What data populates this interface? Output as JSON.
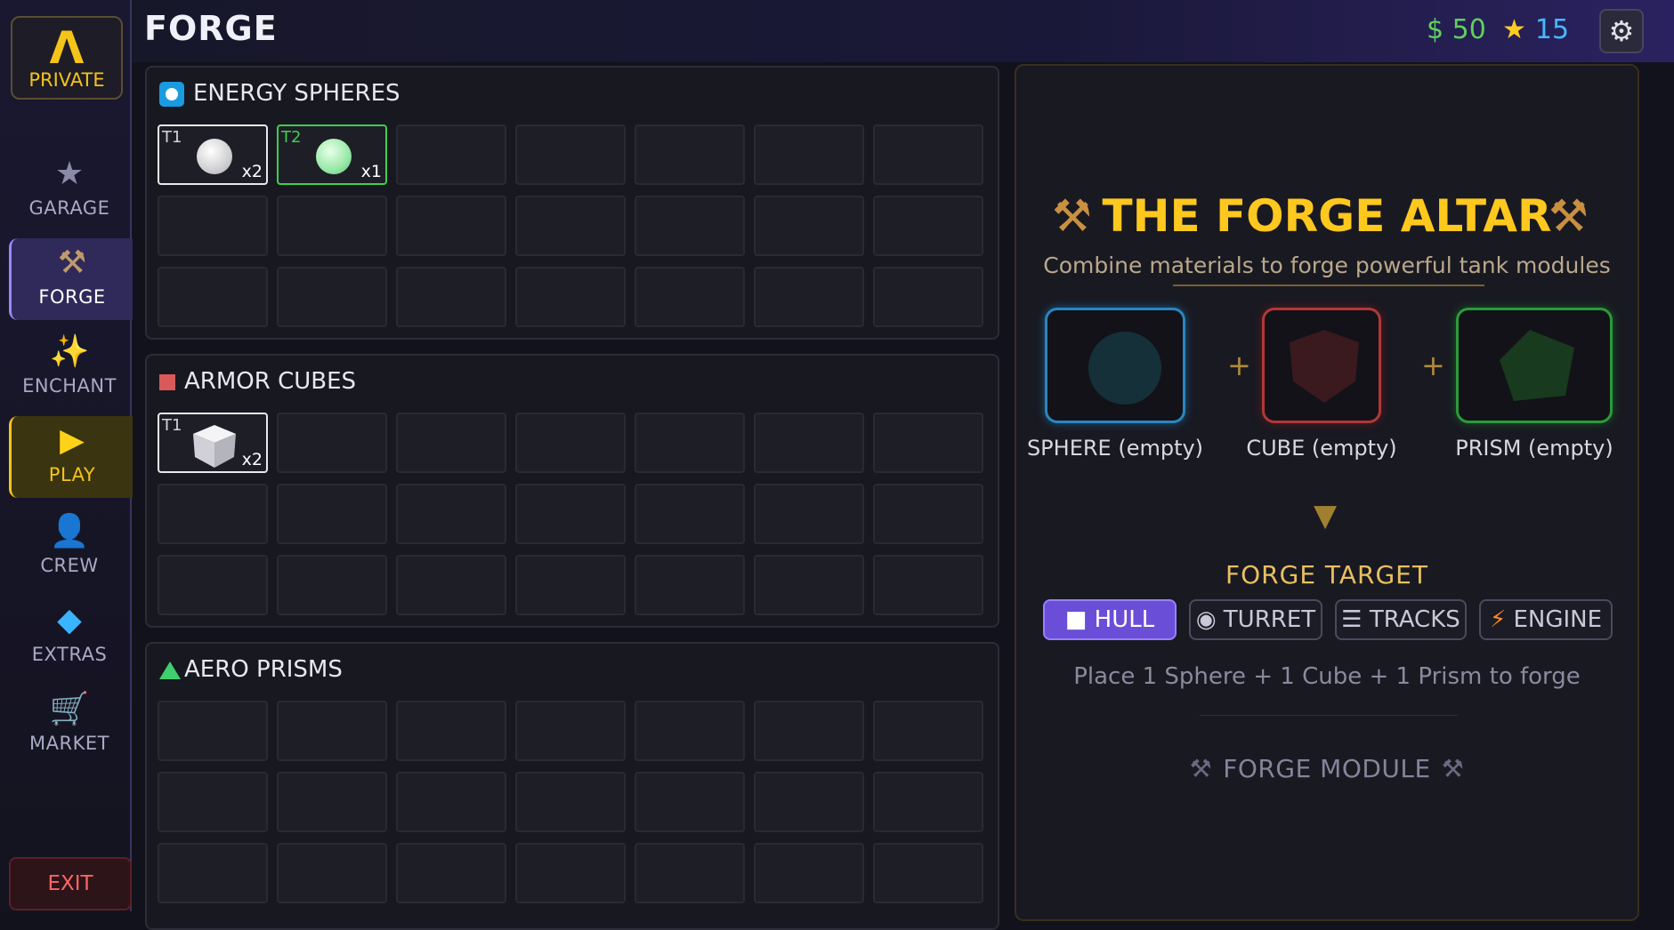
{
  "sidebar": {
    "logo_glyph": "Λ",
    "logo_label": "PRIVATE",
    "items": [
      {
        "label": "GARAGE",
        "icon": "star-icon"
      },
      {
        "label": "FORGE",
        "icon": "hammers-icon"
      },
      {
        "label": "ENCHANT",
        "icon": "sparkles-icon"
      },
      {
        "label": "PLAY",
        "icon": "play-icon"
      },
      {
        "label": "CREW",
        "icon": "person-icon"
      },
      {
        "label": "EXTRAS",
        "icon": "diamond-icon"
      },
      {
        "label": "MARKET",
        "icon": "cart-icon"
      }
    ],
    "exit_label": "EXIT"
  },
  "header": {
    "title": "FORGE",
    "money": "$ 50",
    "stars": "15"
  },
  "colors": {
    "gold": "#ffc81e",
    "money": "#5ed05e",
    "stars": "#46b8ff",
    "selected": "#6a4ed8",
    "sphere": "#2aa8e0",
    "cube": "#d84848",
    "prism": "#3ecf4e"
  },
  "materials": {
    "spheres": {
      "title": "ENERGY SPHERES",
      "items": [
        {
          "tier": "T1",
          "qty": "x2",
          "color": "white"
        },
        {
          "tier": "T2",
          "qty": "x1",
          "color": "green"
        }
      ]
    },
    "cubes": {
      "title": "ARMOR CUBES",
      "items": [
        {
          "tier": "T1",
          "qty": "x2",
          "color": "white"
        }
      ]
    },
    "prisms": {
      "title": "AERO PRISMS",
      "items": []
    }
  },
  "altar": {
    "title": "THE FORGE ALTAR",
    "subtitle": "Combine materials to forge powerful tank modules",
    "sphere_label": "SPHERE (empty)",
    "cube_label": "CUBE (empty)",
    "prism_label": "PRISM (empty)",
    "plus": "+",
    "target_title": "FORGE TARGET",
    "targets": [
      {
        "label": "HULL",
        "icon": "■",
        "selected": true
      },
      {
        "label": "TURRET",
        "icon": "◉",
        "selected": false
      },
      {
        "label": "TRACKS",
        "icon": "☰",
        "selected": false
      },
      {
        "label": "ENGINE",
        "icon": "⚡",
        "selected": false
      }
    ],
    "hint": "Place 1 Sphere  +  1 Cube  +  1 Prism to forge",
    "forge_button": "FORGE MODULE"
  }
}
